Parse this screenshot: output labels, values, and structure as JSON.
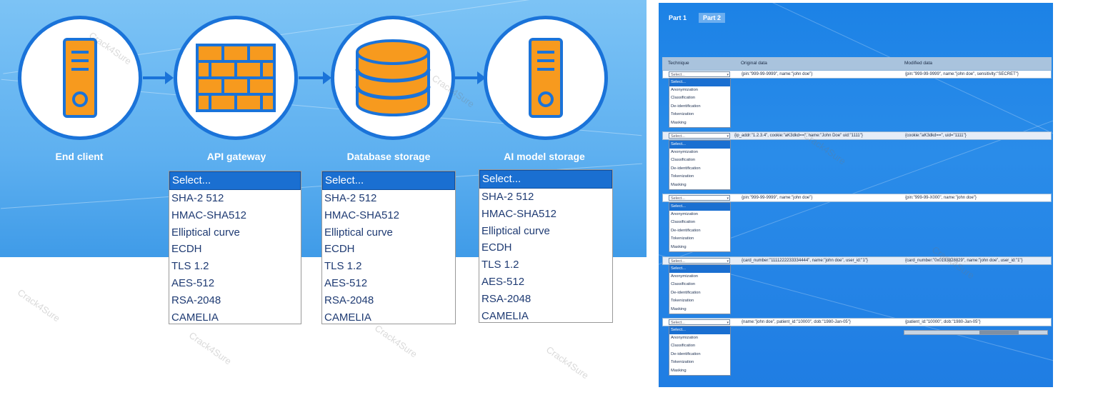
{
  "pipeline": {
    "nodes": [
      {
        "label": "End client"
      },
      {
        "label": "API gateway"
      },
      {
        "label": "Database storage"
      },
      {
        "label": "AI model storage"
      }
    ],
    "dropdowns": [
      {
        "for": "API gateway",
        "selected": "Select...",
        "options": [
          "SHA-2 512",
          "HMAC-SHA512",
          "Elliptical curve",
          "ECDH",
          "TLS 1.2",
          "AES-512",
          "RSA-2048",
          "CAMELIA"
        ]
      },
      {
        "for": "Database storage",
        "selected": "Select...",
        "options": [
          "SHA-2 512",
          "HMAC-SHA512",
          "Elliptical curve",
          "ECDH",
          "TLS 1.2",
          "AES-512",
          "RSA-2048",
          "CAMELIA"
        ]
      },
      {
        "for": "AI model storage",
        "selected": "Select...",
        "options": [
          "SHA-2 512",
          "HMAC-SHA512",
          "Elliptical curve",
          "ECDH",
          "TLS 1.2",
          "AES-512",
          "RSA-2048",
          "CAMELIA"
        ]
      }
    ]
  },
  "tabs": [
    "Part 1",
    "Part 2"
  ],
  "table": {
    "headers": [
      "Technique",
      "Original data",
      "Modified data"
    ],
    "rows": [
      {
        "select": "Select...",
        "original": "{pin:\"999-99-9999\", name:\"john doe\"}",
        "modified": "{pin:\"999-99-9999\", name:\"john doe\", sensitivity:\"SECRET\"}"
      },
      {
        "select": "Select...",
        "original": "{ip_addr:\"1.2.3.4\", cookie:\"aK3dkd==\", name:\"John Doe\" uid:\"1111\"}",
        "modified": "{cookie:\"aK3dkd==\", uid=\"1111\"}"
      },
      {
        "select": "Select...",
        "original": "{pin:\"999-99-9999\", name:\"john doe\"}",
        "modified": "{pin:\"999-99-X000\", name:\"john doe\"}"
      },
      {
        "select": "Select...",
        "original": "{card_number:\"1111222233334444\", name:\"john doe\", user_id:\"1\"}",
        "modified": "{card_number:\"0x0193828829\", name:\"john doe\", user_id:\"1\"}"
      },
      {
        "select": "Select...",
        "original": "{name:\"john doe\", patient_id:\"10000\", dob:\"1980-Jan-05\"}",
        "modified": "{patient_id:\"10000\", dob:\"1980-Jan-05\"}"
      }
    ],
    "technique_options": [
      "Select...",
      "Anonymization",
      "Classification",
      "De-identification",
      "Tokenization",
      "Masking"
    ]
  },
  "watermark": "Crack4Sure"
}
